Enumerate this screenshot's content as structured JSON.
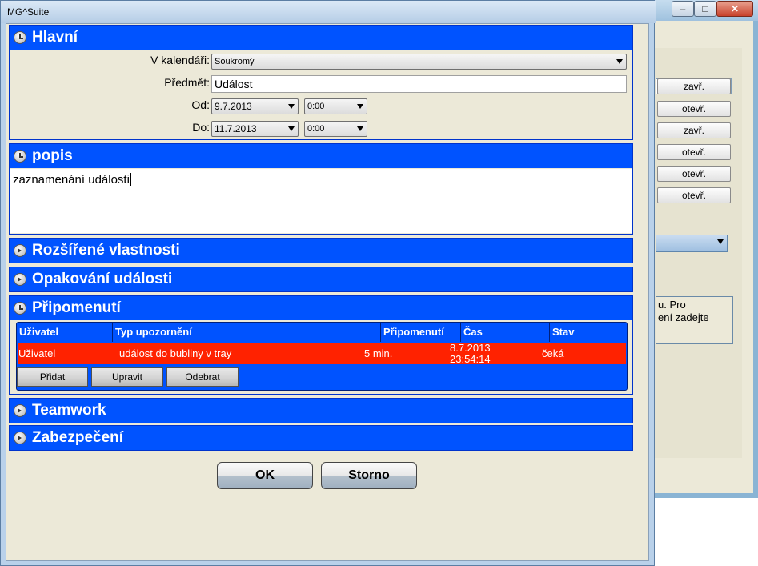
{
  "background_window": {
    "row_buttons": [
      "zavř.",
      "otevř.",
      "zavř.",
      "otevř.",
      "otevř.",
      "otevř."
    ],
    "text_snippet_lines": [
      "u. Pro",
      "ení zadejte"
    ]
  },
  "dialog": {
    "title": "MG^Suite",
    "sections": {
      "main": {
        "title": "Hlavní",
        "calendar_label": "V kalendáři:",
        "calendar_value": "Soukromý",
        "subject_label": "Předmět:",
        "subject_value": "Událost",
        "from_label": "Od:",
        "from_date": "9.7.2013",
        "from_time": "0:00",
        "to_label": "Do:",
        "to_date": "11.7.2013",
        "to_time": "0:00"
      },
      "popis": {
        "title": "popis",
        "text": "zaznamenání události"
      },
      "extended": {
        "title": "Rozšířené vlastnosti"
      },
      "repeat": {
        "title": "Opakování události"
      },
      "reminders": {
        "title": "Připomenutí",
        "columns": [
          "Uživatel",
          "Typ upozornění",
          "Připomenutí",
          "Čas",
          "Stav"
        ],
        "row": {
          "user": "Uživatel",
          "type": "událost do bubliny v tray",
          "reminder": "5 min.",
          "time_date": "8.7.2013",
          "time_clock": "23:54:14",
          "status": "čeká"
        },
        "add_label": "Přidat",
        "edit_label": "Upravit",
        "remove_label": "Odebrat"
      },
      "teamwork": {
        "title": "Teamwork"
      },
      "security": {
        "title": "Zabezpečení"
      }
    },
    "ok_label": "OK",
    "cancel_label": "Storno"
  }
}
